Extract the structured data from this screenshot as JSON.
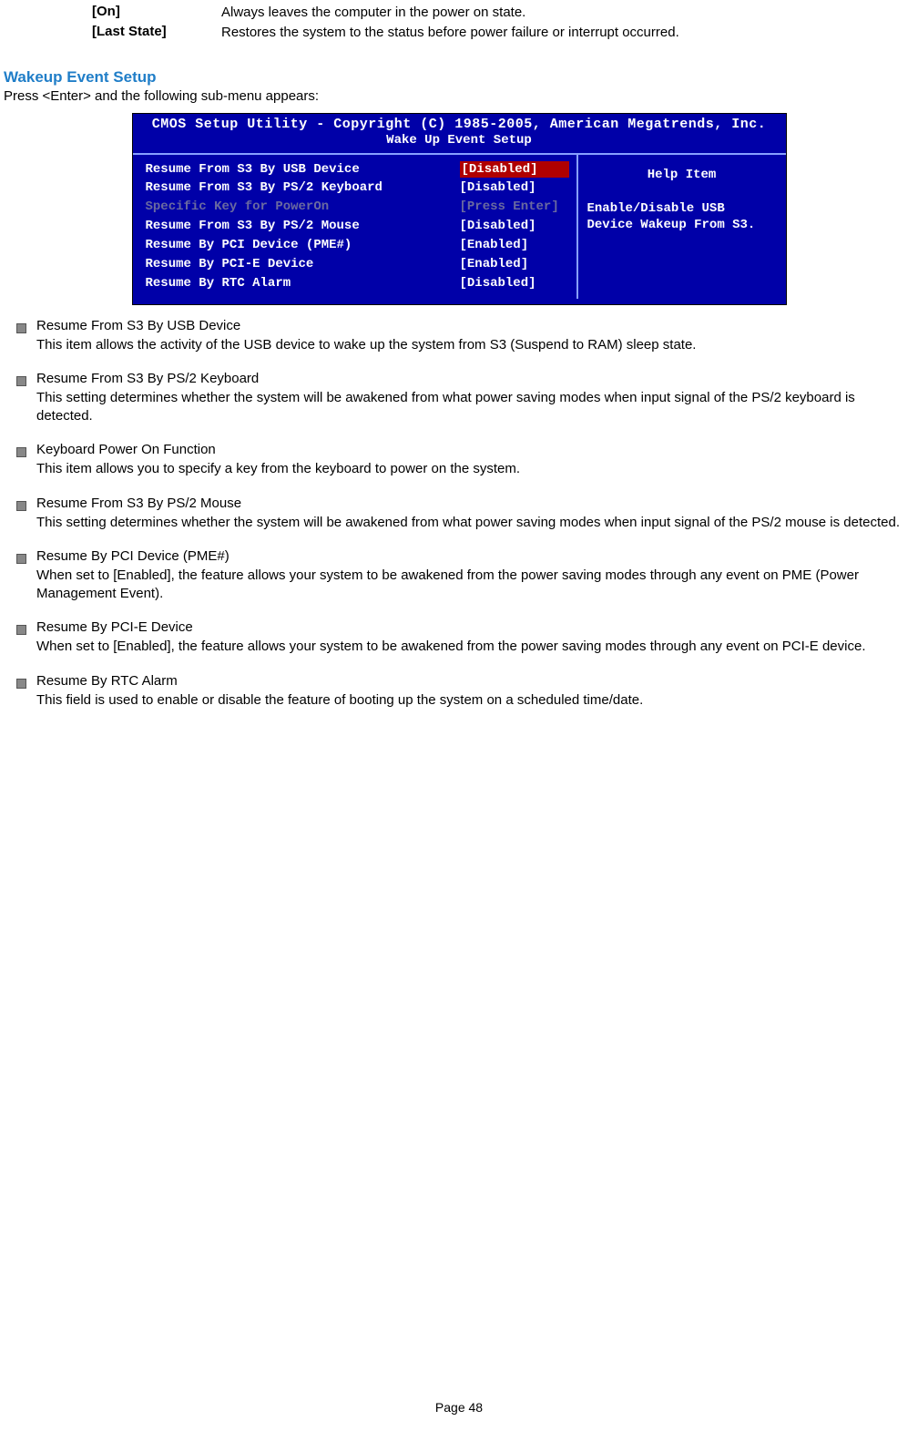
{
  "top_options": [
    {
      "key": "[On]",
      "value": "Always leaves the computer in the power on state."
    },
    {
      "key": "[Last State]",
      "value": "Restores the system to the status before power failure or interrupt occurred."
    }
  ],
  "section_heading": "Wakeup Event Setup",
  "intro": "Press <Enter> and the following sub-menu appears:",
  "bios": {
    "title": "CMOS Setup Utility - Copyright (C) 1985-2005, American Megatrends, Inc.",
    "subtitle": "Wake Up Event Setup",
    "rows": [
      {
        "label": "Resume From S3 By USB Device",
        "value": "[Disabled]",
        "selected": true
      },
      {
        "label": "Resume From S3 By PS/2 Keyboard",
        "value": "[Disabled]"
      },
      {
        "label": "Specific Key for PowerOn",
        "value": "[Press Enter]",
        "inactive": true
      },
      {
        "label": "Resume From S3 By PS/2 Mouse",
        "value": "[Disabled]"
      },
      {
        "label": "Resume By PCI Device (PME#)",
        "value": "[Enabled]"
      },
      {
        "label": "Resume By PCI-E Device",
        "value": "[Enabled]"
      },
      {
        "label": "Resume By RTC Alarm",
        "value": "[Disabled]"
      }
    ],
    "help_title": "Help Item",
    "help_text": "Enable/Disable USB Device Wakeup From S3."
  },
  "items": [
    {
      "title": "Resume From S3 By USB Device",
      "desc": "This item allows the activity of the USB device to wake up the system from S3 (Suspend to RAM) sleep state."
    },
    {
      "title": "Resume From S3 By PS/2 Keyboard",
      "desc": "This setting determines whether the system will be awakened from what power saving modes when input signal of the PS/2 keyboard is detected."
    },
    {
      "title": "Keyboard Power On Function",
      "desc": "This item allows you to specify a key from the keyboard to power on the system."
    },
    {
      "title": "Resume From S3 By PS/2 Mouse",
      "desc": "This setting determines whether the system will be awakened from what power saving modes when input signal of the PS/2 mouse is detected."
    },
    {
      "title": "Resume By PCI Device (PME#)",
      "desc": "When set to [Enabled], the feature allows your system to be awakened from the power saving modes through any event on PME (Power Management Event)."
    },
    {
      "title": "Resume By PCI-E Device",
      "desc": "When set to [Enabled], the feature allows your system to be awakened from the power saving modes through any event on PCI-E device."
    },
    {
      "title": "Resume By RTC Alarm",
      "desc": "This field is used to enable or disable the feature of booting up the system on a scheduled time/date."
    }
  ],
  "page_number": "Page 48"
}
